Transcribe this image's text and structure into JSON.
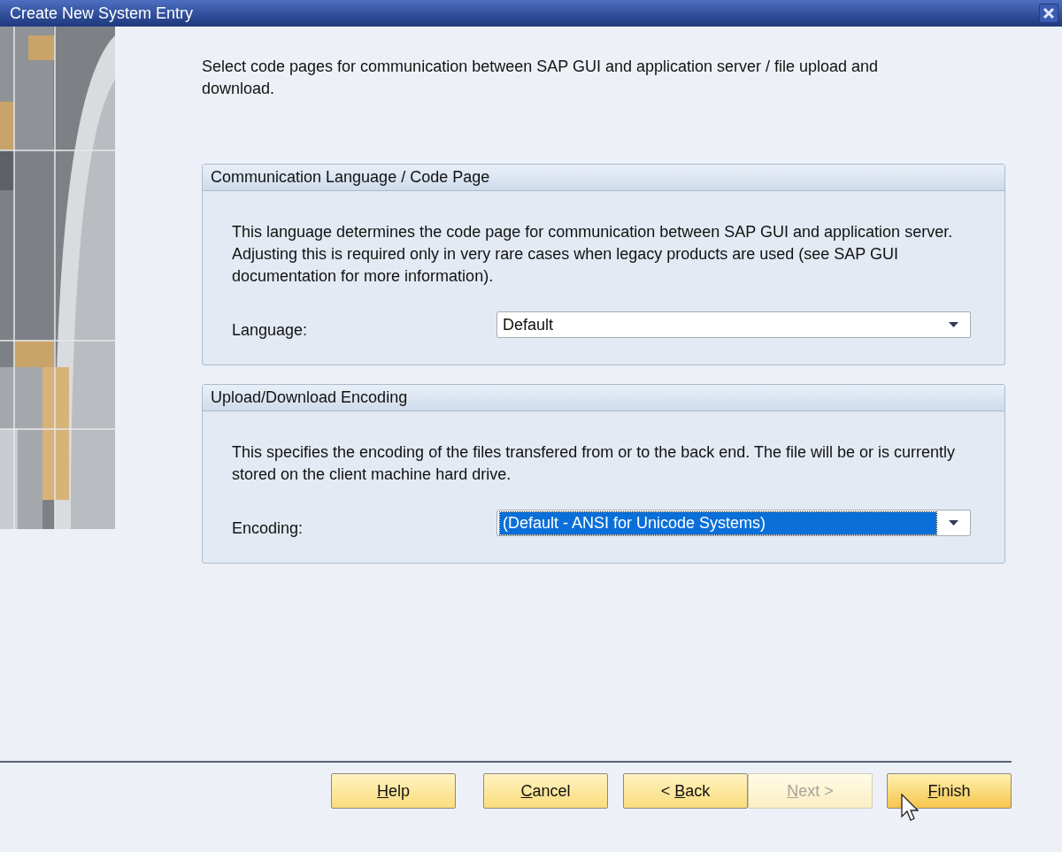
{
  "window": {
    "title": "Create New System Entry"
  },
  "intro": "Select code pages for communication between SAP GUI and application server / file upload and download.",
  "groups": [
    {
      "title": "Communication Language / Code Page",
      "description": "This language determines the code page for communication between SAP GUI and application server. Adjusting this is required only in very rare cases when legacy products are used (see SAP GUI documentation for more information).",
      "field": {
        "label": "Language:",
        "value": "Default",
        "selected": false
      }
    },
    {
      "title": "Upload/Download Encoding",
      "description": "This specifies the encoding of the files transfered from or to the back end. The file will be or is currently stored on the client machine hard drive.",
      "field": {
        "label": "Encoding:",
        "value": "(Default - ANSI for Unicode Systems)",
        "selected": true
      }
    }
  ],
  "buttons": [
    {
      "key": "H",
      "after": "elp",
      "disabled": false,
      "focused": false
    },
    {
      "key": "C",
      "after": "ancel",
      "disabled": false,
      "focused": false
    },
    {
      "before": "< ",
      "key": "B",
      "after": "ack",
      "disabled": false,
      "focused": false
    },
    {
      "key": "N",
      "after": "ext >",
      "disabled": true,
      "focused": false
    },
    {
      "key": "F",
      "after": "inish",
      "disabled": false,
      "focused": true
    }
  ]
}
